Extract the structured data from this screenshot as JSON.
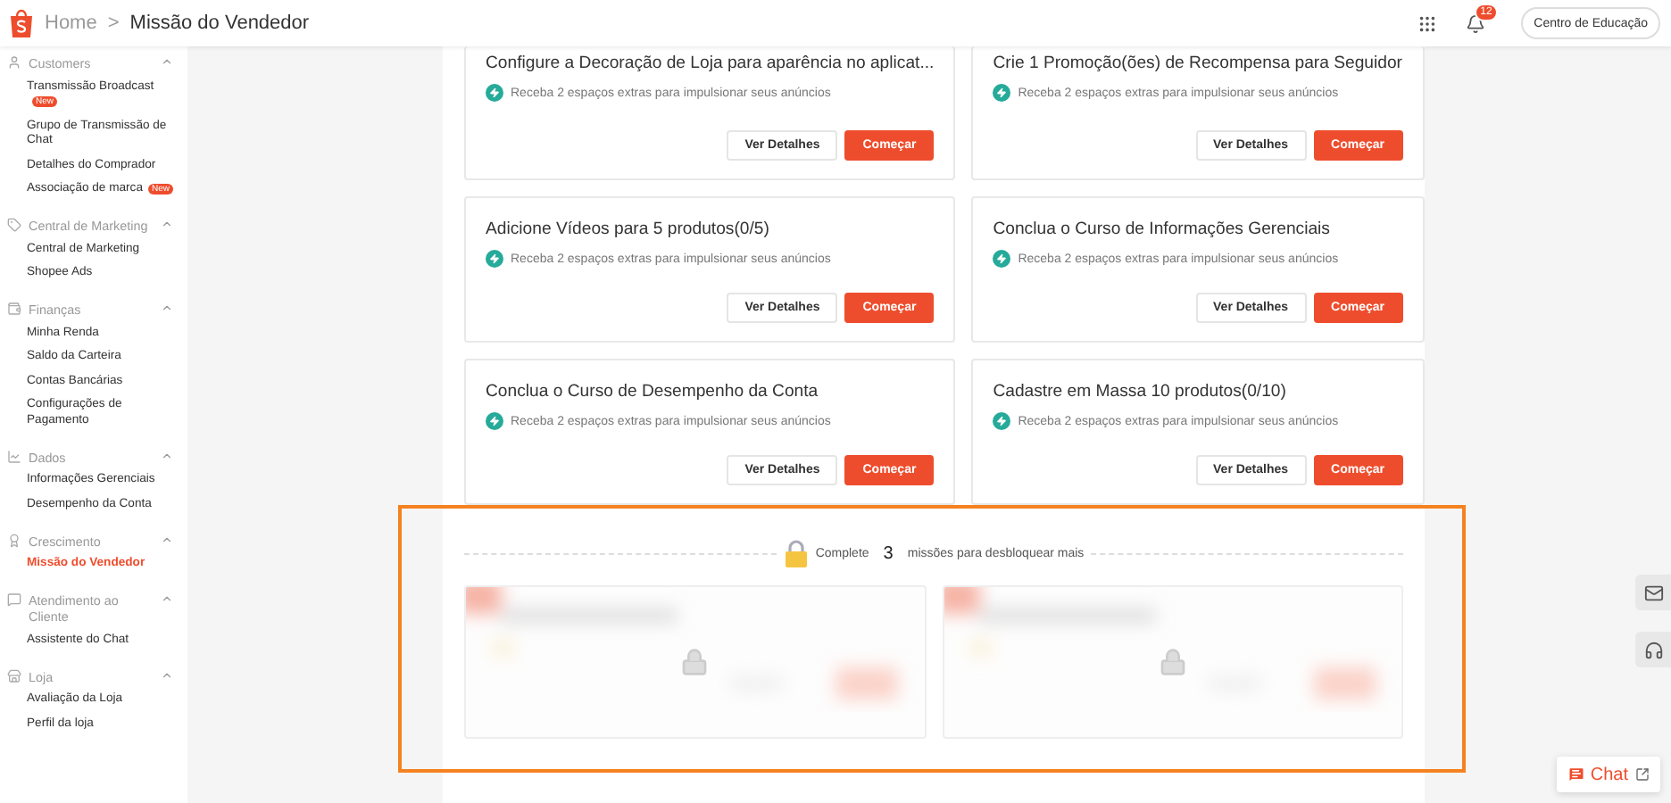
{
  "header": {
    "home": "Home",
    "separator": ">",
    "current": "Missão do Vendedor",
    "notifications": "12",
    "education": "Centro de Educação"
  },
  "sidebar": [
    {
      "title": "Customers",
      "expanded": true,
      "items": [
        {
          "label": "Transmissão Broadcast",
          "badge": "New",
          "selected": false
        },
        {
          "label": "Grupo de Transmissão de Chat",
          "selected": false
        },
        {
          "label": "Detalhes do Comprador",
          "selected": false
        },
        {
          "label": "Associação de marca",
          "badge": "New",
          "selected": false
        }
      ]
    },
    {
      "title": "Central de Marketing",
      "expanded": true,
      "items": [
        {
          "label": "Central de Marketing",
          "selected": false
        },
        {
          "label": "Shopee Ads",
          "selected": false
        }
      ]
    },
    {
      "title": "Finanças",
      "expanded": true,
      "items": [
        {
          "label": "Minha Renda",
          "selected": false
        },
        {
          "label": "Saldo da Carteira",
          "selected": false
        },
        {
          "label": "Contas Bancárias",
          "selected": false
        },
        {
          "label": "Configurações de Pagamento",
          "selected": false
        }
      ]
    },
    {
      "title": "Dados",
      "expanded": true,
      "items": [
        {
          "label": "Informações Gerenciais",
          "selected": false
        },
        {
          "label": "Desempenho da Conta",
          "selected": false
        }
      ]
    },
    {
      "title": "Crescimento",
      "expanded": true,
      "items": [
        {
          "label": "Missão do Vendedor",
          "selected": true
        }
      ]
    },
    {
      "title": "Atendimento ao Cliente",
      "expanded": true,
      "items": [
        {
          "label": "Assistente do Chat",
          "selected": false
        }
      ]
    },
    {
      "title": "Loja",
      "expanded": true,
      "items": [
        {
          "label": "Avaliação da Loja",
          "selected": false
        },
        {
          "label": "Perfil da loja",
          "selected": false
        }
      ]
    }
  ],
  "missions": [
    {
      "title": "Configure a Decoração de Loja para aparência no aplicat...",
      "reward": "Receba 2 espaços extras para impulsionar seus anúncios",
      "details": "Ver Detalhes",
      "start": "Começar"
    },
    {
      "title": "Crie 1 Promoção(ões) de Recompensa para Seguidor",
      "reward": "Receba 2 espaços extras para impulsionar seus anúncios",
      "details": "Ver Detalhes",
      "start": "Começar"
    },
    {
      "title": "Adicione Vídeos para 5 produtos(0/5)",
      "reward": "Receba 2 espaços extras para impulsionar seus anúncios",
      "details": "Ver Detalhes",
      "start": "Começar"
    },
    {
      "title": "Conclua o Curso de Informações Gerenciais",
      "reward": "Receba 2 espaços extras para impulsionar seus anúncios",
      "details": "Ver Detalhes",
      "start": "Começar"
    },
    {
      "title": "Conclua o Curso de Desempenho da Conta",
      "reward": "Receba 2 espaços extras para impulsionar seus anúncios",
      "details": "Ver Detalhes",
      "start": "Começar"
    },
    {
      "title": "Cadastre em Massa 10 produtos(0/10)",
      "reward": "Receba 2 espaços extras para impulsionar seus anúncios",
      "details": "Ver Detalhes",
      "start": "Começar"
    }
  ],
  "locked_section": {
    "highlighted": true,
    "prefix": "Complete",
    "count": "3",
    "suffix": "missões para desbloquear mais",
    "cards": [
      {
        "locked": true
      },
      {
        "locked": true
      }
    ]
  },
  "chat": {
    "label": "Chat"
  }
}
